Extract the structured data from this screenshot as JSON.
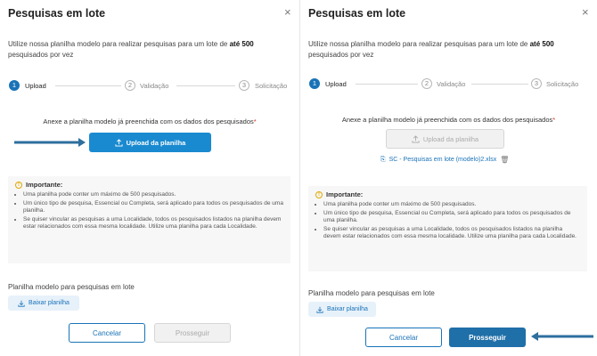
{
  "left": {
    "title": "Pesquisas em lote",
    "close_icon": "×",
    "intro": "Utilize nossa planilha modelo para realizar pesquisas para um lote de",
    "intro_bold": "até 500",
    "intro_tail": "pesquisados por vez",
    "steps": [
      {
        "num": "1",
        "label": "Upload"
      },
      {
        "num": "2",
        "label": "Validação"
      },
      {
        "num": "3",
        "label": "Solicitação"
      }
    ],
    "annex_text": "Anexe a planilha modelo já preenchida com os dados dos pesquisados",
    "annex_req": "*",
    "upload_label": "Upload da planilha",
    "notice_title": "Importante:",
    "notice_items": [
      "Uma planilha pode conter um máximo de 500 pesquisados.",
      "Um único tipo de pesquisa, Essencial ou Completa, será aplicado para todos os pesquisados de uma planilha.",
      "Se quiser vincular as pesquisas a uma Localidade, todos os pesquisados listados na planilha devem estar relacionados com essa mesma localidade. Utilize uma planilha para cada Localidade."
    ],
    "sheet_label": "Planilha modelo para pesquisas em lote",
    "download_label": "Baixar planilha",
    "cancel_label": "Cancelar",
    "next_label": "Prosseguir"
  },
  "right": {
    "title": "Pesquisas em lote",
    "close_icon": "×",
    "intro": "Utilize nossa planilha modelo para realizar pesquisas para um lote de",
    "intro_bold": "até 500",
    "intro_tail": "pesquisados por vez",
    "steps": [
      {
        "num": "1",
        "label": "Upload"
      },
      {
        "num": "2",
        "label": "Validação"
      },
      {
        "num": "3",
        "label": "Solicitação"
      }
    ],
    "annex_text": "Anexe a planilha modelo já preenchida com os dados dos pesquisados",
    "annex_req": "*",
    "upload_label": "Upload da planilha",
    "file_name": "SC - Pesquisas em lote (modelo)2.xlsx",
    "notice_title": "Importante:",
    "notice_items": [
      "Uma planilha pode conter um máximo de 500 pesquisados.",
      "Um único tipo de pesquisa, Essencial ou Completa, será aplicado para todos os pesquisados de uma planilha.",
      "Se quiser vincular as pesquisas a uma Localidade, todos os pesquisados listados na planilha devem estar relacionados com essa mesma localidade. Utilize uma planilha para cada Localidade."
    ],
    "sheet_label": "Planilha modelo para pesquisas em lote",
    "download_label": "Baixar planilha",
    "cancel_label": "Cancelar",
    "next_label": "Prosseguir"
  },
  "colors": {
    "primary": "#1a8ad0",
    "primary_dark": "#1f6fa8",
    "arrow": "#2d6f9e",
    "required": "#d93025",
    "warning": "#e0a800"
  },
  "icons": {
    "upload": "upload-icon",
    "download": "download-icon",
    "close": "close-icon",
    "warning": "warning-icon",
    "file": "file-icon",
    "trash": "trash-icon"
  }
}
